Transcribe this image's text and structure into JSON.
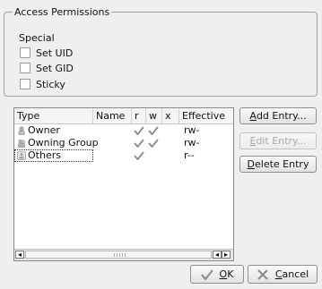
{
  "permissions": {
    "group_title": "Access Permissions",
    "special_label": "Special",
    "options": [
      {
        "label": "Set UID",
        "checked": false
      },
      {
        "label": "Set GID",
        "checked": false
      },
      {
        "label": "Sticky",
        "checked": false
      }
    ]
  },
  "table": {
    "columns": [
      "Type",
      "Name",
      "r",
      "w",
      "x",
      "Effective"
    ],
    "rows": [
      {
        "type": "Owner",
        "name": "",
        "r": true,
        "w": true,
        "x": false,
        "effective": "rw-",
        "icon": "user-icon"
      },
      {
        "type": "Owning Group",
        "name": "",
        "r": true,
        "w": true,
        "x": false,
        "effective": "rw-",
        "icon": "group-icon"
      },
      {
        "type": "Others",
        "name": "",
        "r": true,
        "w": false,
        "x": false,
        "effective": "r--",
        "icon": "others-icon"
      }
    ]
  },
  "buttons": {
    "add_entry": {
      "label_ul": "A",
      "label_rest": "dd Entry...",
      "enabled": true
    },
    "edit_entry": {
      "label_ul": "E",
      "label_rest": "dit Entry...",
      "enabled": false
    },
    "delete_entry": {
      "label_ul": "D",
      "label_rest": "elete Entry",
      "enabled": true
    },
    "ok": {
      "label_ul": "O",
      "label_rest": "K",
      "icon": "checkmark-icon"
    },
    "cancel": {
      "label_ul": "C",
      "label_rest": "ancel",
      "icon": "cancel-icon"
    }
  },
  "colors": {
    "check_gray": "#888888"
  }
}
